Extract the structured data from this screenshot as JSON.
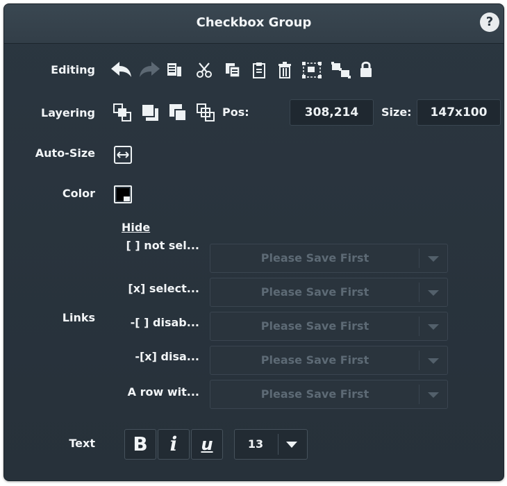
{
  "window": {
    "title": "Checkbox Group",
    "help_label": "?"
  },
  "rows": {
    "editing": "Editing",
    "layering": "Layering",
    "auto_size": "Auto-Size",
    "color": "Color",
    "links": "Links",
    "text": "Text"
  },
  "layering": {
    "pos_label": "Pos:",
    "pos_value": "308,214",
    "size_label": "Size:",
    "size_value": "147x100"
  },
  "links": {
    "hide_label": "Hide",
    "items": [
      {
        "label": "[ ] not sel...",
        "value": "Please Save First"
      },
      {
        "label": "[x] select...",
        "value": "Please Save First"
      },
      {
        "label": "-[ ] disab...",
        "value": "Please Save First"
      },
      {
        "label": "-[x] disa...",
        "value": "Please Save First"
      },
      {
        "label": "A row wit...",
        "value": "Please Save First"
      }
    ]
  },
  "text": {
    "bold": "B",
    "italic": "i",
    "underline": "u",
    "font_size": "13"
  },
  "colors": {
    "panel": "#2b3640",
    "swatch": "#000000"
  }
}
